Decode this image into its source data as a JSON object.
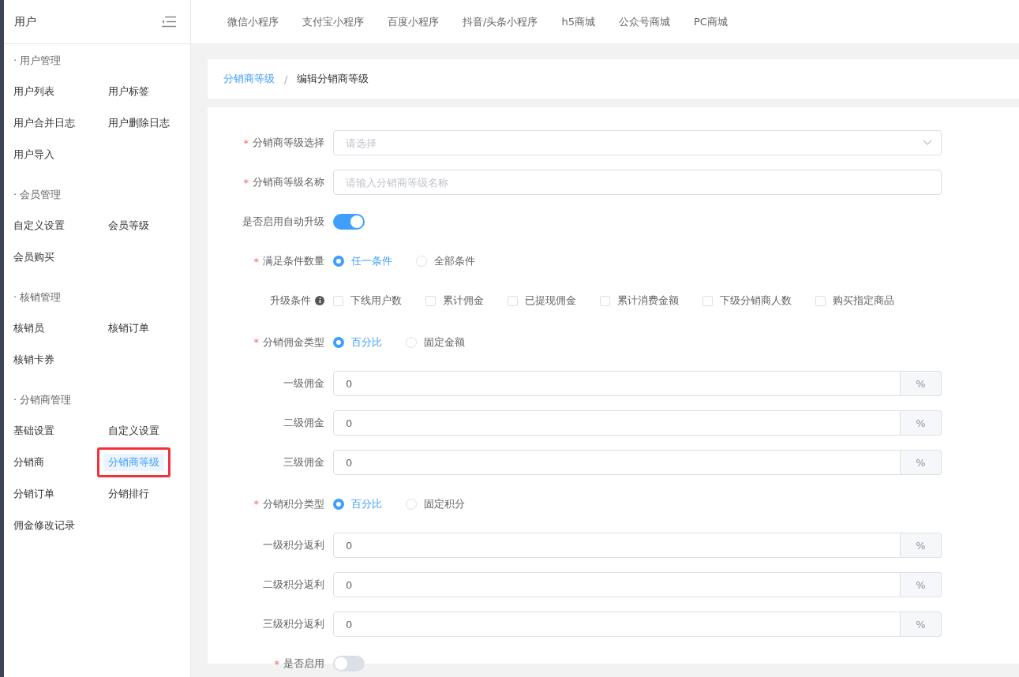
{
  "sidebar": {
    "title": "用户",
    "groups": [
      {
        "title": "· 用户管理",
        "items": [
          {
            "label": "用户列表",
            "selected": false,
            "highlighted": false
          },
          {
            "label": "用户标签",
            "selected": false,
            "highlighted": false
          },
          {
            "label": "用户合并日志",
            "selected": false,
            "highlighted": false
          },
          {
            "label": "用户删除日志",
            "selected": false,
            "highlighted": false
          },
          {
            "label": "用户导入",
            "selected": false,
            "highlighted": false
          }
        ]
      },
      {
        "title": "· 会员管理",
        "items": [
          {
            "label": "自定义设置",
            "selected": false,
            "highlighted": false
          },
          {
            "label": "会员等级",
            "selected": false,
            "highlighted": false
          },
          {
            "label": "会员购买",
            "selected": false,
            "highlighted": false
          }
        ]
      },
      {
        "title": "· 核销管理",
        "items": [
          {
            "label": "核销员",
            "selected": false,
            "highlighted": false
          },
          {
            "label": "核销订单",
            "selected": false,
            "highlighted": false
          },
          {
            "label": "核销卡券",
            "selected": false,
            "highlighted": false
          }
        ]
      },
      {
        "title": "· 分销商管理",
        "items": [
          {
            "label": "基础设置",
            "selected": false,
            "highlighted": false
          },
          {
            "label": "自定义设置",
            "selected": false,
            "highlighted": false
          },
          {
            "label": "分销商",
            "selected": false,
            "highlighted": false
          },
          {
            "label": "分销商等级",
            "selected": true,
            "highlighted": true
          },
          {
            "label": "分销订单",
            "selected": false,
            "highlighted": false
          },
          {
            "label": "分销排行",
            "selected": false,
            "highlighted": false
          },
          {
            "label": "佣金修改记录",
            "selected": false,
            "highlighted": false
          }
        ]
      }
    ]
  },
  "top_tabs": [
    "微信小程序",
    "支付宝小程序",
    "百度小程序",
    "抖音/头条小程序",
    "h5商城",
    "公众号商城",
    "PC商城"
  ],
  "breadcrumb": {
    "link": "分销商等级",
    "separator": "/",
    "current": "编辑分销商等级"
  },
  "form": [
    {
      "kind": "select",
      "label": "分销商等级选择",
      "required": "*",
      "placeholder": "请选择"
    },
    {
      "kind": "text",
      "label": "分销商等级名称",
      "required": "*",
      "placeholder": "请输入分销商等级名称"
    },
    {
      "kind": "switch",
      "label": "是否启用自动升级",
      "on": true
    },
    {
      "kind": "radio",
      "label": "满足条件数量",
      "required": "*",
      "options": [
        {
          "label": "任一条件",
          "selected": true
        },
        {
          "label": "全部条件",
          "selected": false
        }
      ]
    },
    {
      "kind": "checkbox",
      "label": "升级条件",
      "info": true,
      "options": [
        {
          "label": "下线用户数",
          "checked": false
        },
        {
          "label": "累计佣金",
          "checked": false
        },
        {
          "label": "已提现佣金",
          "checked": false
        },
        {
          "label": "累计消费金额",
          "checked": false
        },
        {
          "label": "下级分销商人数",
          "checked": false
        },
        {
          "label": "购买指定商品",
          "checked": false
        }
      ]
    },
    {
      "kind": "radio",
      "label": "分销佣金类型",
      "required": "*",
      "options": [
        {
          "label": "百分比",
          "selected": true
        },
        {
          "label": "固定金额",
          "selected": false
        }
      ]
    },
    {
      "kind": "suffix",
      "label": "一级佣金",
      "value": "0",
      "suffix": "%"
    },
    {
      "kind": "suffix",
      "label": "二级佣金",
      "value": "0",
      "suffix": "%"
    },
    {
      "kind": "suffix",
      "label": "三级佣金",
      "value": "0",
      "suffix": "%"
    },
    {
      "kind": "radio",
      "label": "分销积分类型",
      "required": "*",
      "options": [
        {
          "label": "百分比",
          "selected": true
        },
        {
          "label": "固定积分",
          "selected": false
        }
      ]
    },
    {
      "kind": "suffix",
      "label": "一级积分返利",
      "value": "0",
      "suffix": "%"
    },
    {
      "kind": "suffix",
      "label": "二级积分返利",
      "value": "0",
      "suffix": "%"
    },
    {
      "kind": "suffix",
      "label": "三级积分返利",
      "value": "0",
      "suffix": "%"
    },
    {
      "kind": "switch",
      "label": "是否启用",
      "required": "*",
      "on": false
    }
  ]
}
